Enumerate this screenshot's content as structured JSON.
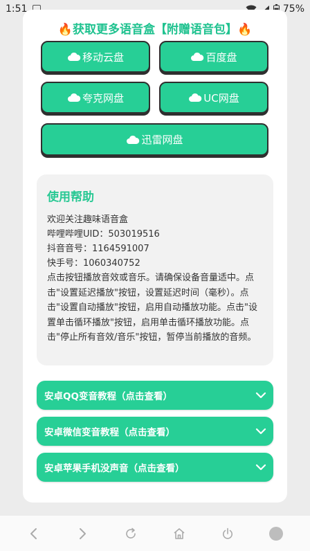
{
  "status": {
    "time": "1:51",
    "battery": "75%"
  },
  "headline": {
    "fire_left": "🔥",
    "text": "获取更多语音盒【附赠语音包】",
    "fire_right": "🔥"
  },
  "downloads": [
    {
      "label": "移动云盘"
    },
    {
      "label": "百度盘"
    },
    {
      "label": "夸克网盘"
    },
    {
      "label": "UC网盘"
    },
    {
      "label": "迅雷网盘"
    }
  ],
  "help": {
    "title": "使用帮助",
    "lines": [
      "欢迎关注趣味语音盒",
      "哔哩哔哩UID：503019516",
      "抖音音号：1164591007",
      "快手号：1060340752"
    ],
    "paragraph": "点击按钮播放音效或音乐。请确保设备音量适中。点击\"设置延迟播放\"按钮，设置延迟时间（毫秒）。点击\"设置自动播放\"按钮，启用自动播放功能。点击\"设置单击循环播放\"按钮，启用单击循环播放功能。点击\"停止所有音效/音乐\"按钮，暂停当前播放的音频。"
  },
  "tutorials": [
    {
      "label": "安卓QQ变音教程（点击查看）"
    },
    {
      "label": "安卓微信变音教程（点击查看）"
    },
    {
      "label": "安卓苹果手机没声音（点击查看）"
    }
  ],
  "colors": {
    "accent": "#27cf96",
    "title_green": "#27c893",
    "border": "#2f2f2f"
  },
  "icons": {
    "download_button": "cloud-icon",
    "accordion": "chevron-down-icon",
    "nav": [
      "back-arrow-icon",
      "forward-arrow-icon",
      "refresh-icon",
      "home-icon",
      "power-icon",
      "circle-icon"
    ]
  }
}
